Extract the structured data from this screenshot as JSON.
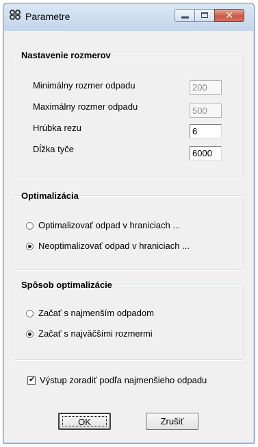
{
  "window": {
    "title": "Parametre",
    "icon": "app-rings-icon",
    "controls": {
      "minimize": "minimize-icon",
      "maximize": "maximize-icon",
      "close": "✕"
    }
  },
  "dimensions_group": {
    "title": "Nastavenie rozmerov",
    "fields": [
      {
        "label": "Minimálny rozmer odpadu",
        "value": "200",
        "disabled": true
      },
      {
        "label": "Maximálny rozmer odpadu",
        "value": "500",
        "disabled": true
      },
      {
        "label": "Hrúbka rezu",
        "value": "6",
        "disabled": false
      },
      {
        "label": "Dĺžka tyče",
        "value": "6000",
        "disabled": false
      }
    ]
  },
  "optimization_group": {
    "title": "Optimalizácia",
    "options": [
      {
        "label": "Optimalizovať odpad v hraniciach ...",
        "checked": false
      },
      {
        "label": "Neoptimalizovať odpad v hraniciach ...",
        "checked": true
      }
    ]
  },
  "method_group": {
    "title": "Spôsob optimalizácie",
    "options": [
      {
        "label": "Začať s najmenším odpadom",
        "checked": false
      },
      {
        "label": "Začať s najväčšími rozmermi",
        "checked": true
      }
    ]
  },
  "sort_checkbox": {
    "label": "Výstup zoradiť podľa najmenšieho odpadu",
    "checked": true,
    "mark": "✔"
  },
  "buttons": {
    "ok": "OK",
    "cancel": "Zrušiť"
  }
}
